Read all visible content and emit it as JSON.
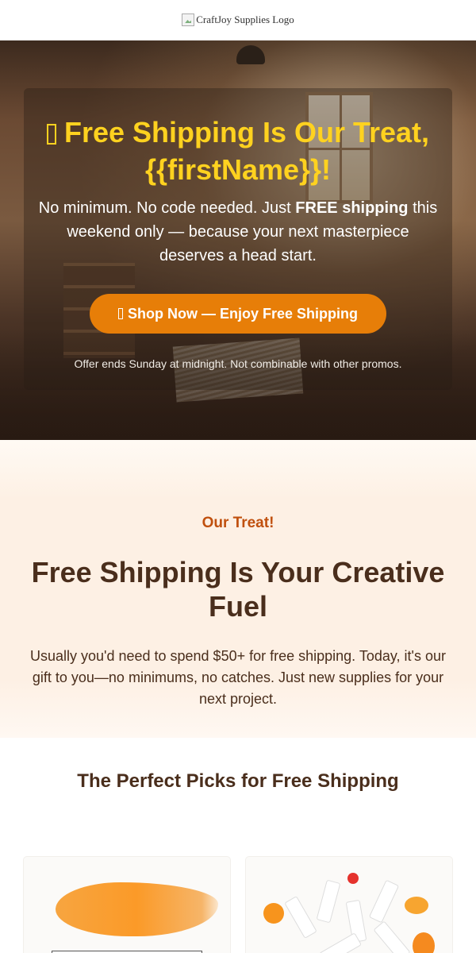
{
  "header": {
    "logo_alt": "CraftJoy Supplies Logo"
  },
  "hero": {
    "title": "Free Shipping Is Our Treat, {{firstName}}!",
    "text_before": "No minimum. No code needed. Just ",
    "text_bold": "FREE shipping",
    "text_after": " this weekend only — because your next masterpiece deserves a head start.",
    "cta_label": "Shop Now — Enjoy Free Shipping",
    "note": "Offer ends Sunday at midnight. Not combinable with other promos."
  },
  "treat": {
    "eyebrow": "Our Treat!",
    "title": "Free Shipping Is Your Creative Fuel",
    "text": "Usually you'd need to spend $50+ for free shipping. Today, it's our gift to you—no minimums, no catches. Just new supplies for your next project."
  },
  "picks": {
    "title": "The Perfect Picks for Free Shipping"
  },
  "colors": {
    "accent": "#e77e08",
    "title_yellow": "#ffd21f",
    "eyebrow": "#c0500e",
    "text_brown": "#4a2e1c",
    "section_bg": "#fdf0e4"
  }
}
